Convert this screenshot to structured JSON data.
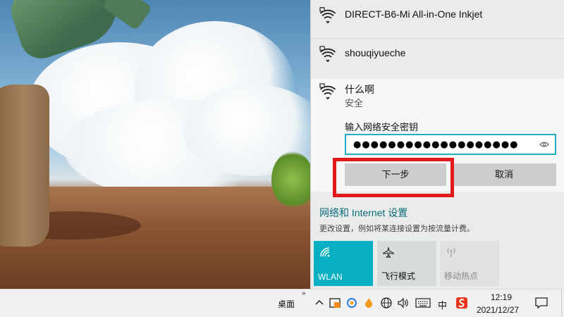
{
  "networks": [
    {
      "name": "DIRECT-B6-Mi All-in-One Inkjet",
      "icon": "wifi-secured-icon"
    },
    {
      "name": "shouqiyueche",
      "icon": "wifi-secured-icon"
    },
    {
      "name": "什么啊",
      "status": "安全",
      "icon": "wifi-secured-icon"
    }
  ],
  "connect": {
    "password_label": "输入网络安全密钥",
    "password_value": "●●●●●●●●●●●●●●●●●●●",
    "next_label": "下一步",
    "cancel_label": "取消"
  },
  "settings": {
    "title": "网络和 Internet 设置",
    "description": "更改设置，例如将某连接设置为按流量计费。"
  },
  "quick_actions": [
    {
      "label": "WLAN",
      "icon": "wlan-icon",
      "active": true
    },
    {
      "label": "飞行模式",
      "icon": "airplane-icon",
      "active": false
    },
    {
      "label": "移动热点",
      "icon": "hotspot-icon",
      "active": false
    }
  ],
  "taskbar": {
    "desktop_label": "桌面",
    "chevron": "»",
    "ime_label": "中",
    "time": "12:19",
    "date": "2021/12/27"
  },
  "colors": {
    "accent": "#06afc2",
    "highlight": "#e11b1b",
    "settings_link": "#0b6a7a"
  }
}
